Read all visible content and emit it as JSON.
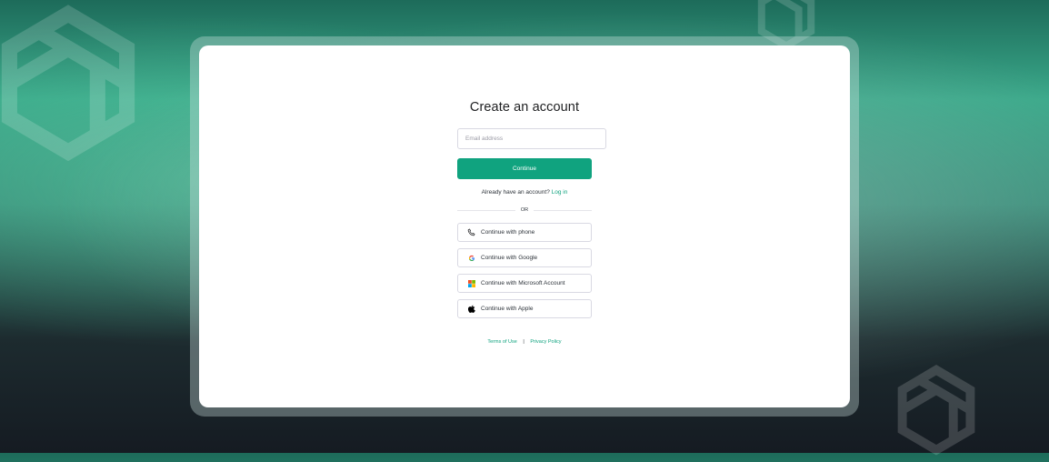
{
  "signup": {
    "title": "Create an account",
    "email_placeholder": "Email address",
    "continue_label": "Continue",
    "already_text": "Already have an account?",
    "login_link": "Log in",
    "or_label": "OR",
    "options": {
      "phone": {
        "label": "Continue with phone",
        "icon": "phone-icon"
      },
      "google": {
        "label": "Continue with Google",
        "icon": "google-icon"
      },
      "microsoft": {
        "label": "Continue with Microsoft Account",
        "icon": "microsoft-icon"
      },
      "apple": {
        "label": "Continue with Apple",
        "icon": "apple-icon"
      }
    }
  },
  "footer": {
    "terms": "Terms of Use",
    "separator": "|",
    "privacy": "Privacy Policy"
  },
  "colors": {
    "accent": "#10a37f",
    "text": "#2d333a",
    "border": "#d9d9e3"
  }
}
